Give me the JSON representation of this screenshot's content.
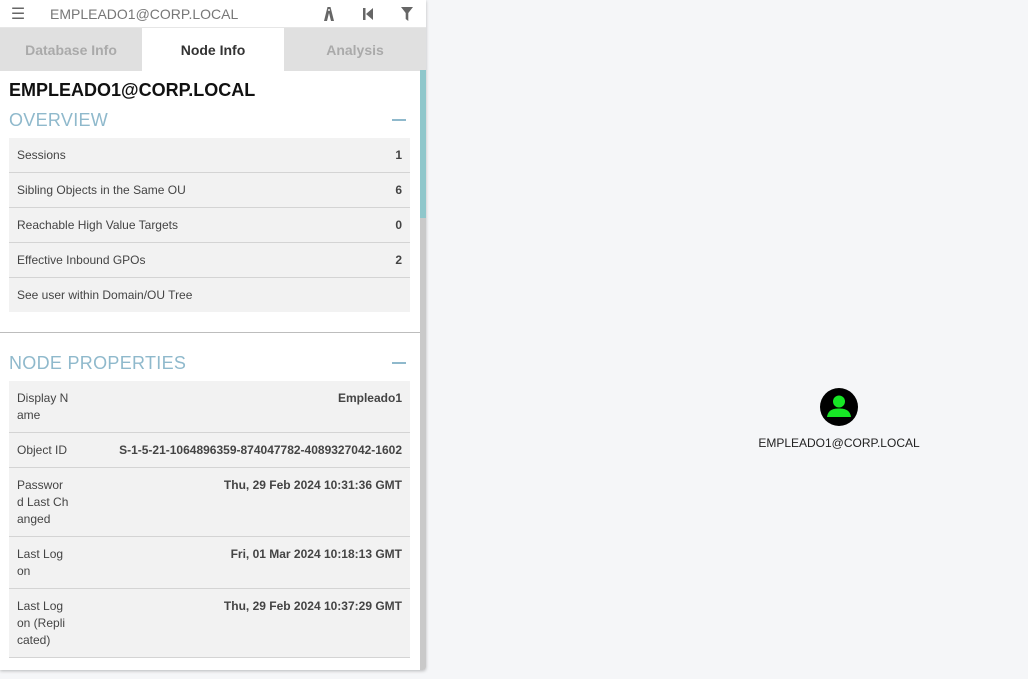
{
  "search": {
    "placeholder": "EMPLEADO1@CORP.LOCAL"
  },
  "toolbar": {
    "menu_icon": "hamburger-icon",
    "icons": [
      "pathfinding-icon",
      "back-icon",
      "filter-icon"
    ]
  },
  "tabs": [
    {
      "label": "Database Info",
      "active": false
    },
    {
      "label": "Node Info",
      "active": true
    },
    {
      "label": "Analysis",
      "active": false
    }
  ],
  "node": {
    "title": "EMPLEADO1@CORP.LOCAL"
  },
  "overview": {
    "title": "OVERVIEW",
    "rows": [
      {
        "label": "Sessions",
        "value": "1"
      },
      {
        "label": "Sibling Objects in the Same OU",
        "value": "6"
      },
      {
        "label": "Reachable High Value Targets",
        "value": "0"
      },
      {
        "label": "Effective Inbound GPOs",
        "value": "2"
      }
    ],
    "link_label": "See user within Domain/OU Tree"
  },
  "properties": {
    "title": "NODE PROPERTIES",
    "rows": [
      {
        "label": "Display Name",
        "value": "Empleado1"
      },
      {
        "label": "Object ID",
        "value": "S-1-5-21-1064896359-874047782-4089327042-1602"
      },
      {
        "label": "Password Last Changed",
        "value": "Thu, 29 Feb 2024 10:31:36 GMT"
      },
      {
        "label": "Last Logon",
        "value": "Fri, 01 Mar 2024 10:18:13 GMT"
      },
      {
        "label": "Last Logon (Replicated)",
        "value": "Thu, 29 Feb 2024 10:37:29 GMT"
      }
    ]
  },
  "graph": {
    "node_label": "EMPLEADO1@CORP.LOCAL",
    "node_icon": "user-icon",
    "node_color": "#17e625"
  },
  "colors": {
    "accent": "#8fb9cc",
    "scroll_thumb": "#8fc7cb"
  }
}
